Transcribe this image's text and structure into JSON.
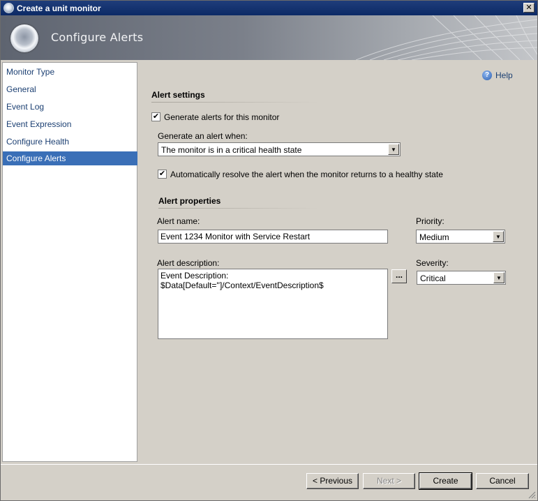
{
  "window": {
    "title": "Create a unit monitor",
    "close_label": "✕"
  },
  "banner": {
    "title": "Configure Alerts"
  },
  "sidebar": {
    "items": [
      {
        "label": "Monitor Type"
      },
      {
        "label": "General"
      },
      {
        "label": "Event Log"
      },
      {
        "label": "Event Expression"
      },
      {
        "label": "Configure Health"
      },
      {
        "label": "Configure Alerts",
        "selected": true
      }
    ]
  },
  "help": {
    "label": "Help",
    "icon": "help-icon"
  },
  "alert_settings": {
    "title": "Alert settings",
    "generate_alerts": {
      "label": "Generate alerts for this monitor",
      "checked": true
    },
    "generate_when": {
      "label": "Generate an alert when:",
      "value": "The monitor is in a critical health state"
    },
    "auto_resolve": {
      "label": "Automatically resolve the alert when the monitor returns to a healthy state",
      "checked": true
    }
  },
  "alert_properties": {
    "title": "Alert properties",
    "alert_name": {
      "label": "Alert name:",
      "value": "Event 1234 Monitor with Service Restart"
    },
    "priority": {
      "label": "Priority:",
      "value": "Medium"
    },
    "alert_description": {
      "label": "Alert description:",
      "value": "Event Description: $Data[Default='']/Context/EventDescription$"
    },
    "ellipsis_label": "...",
    "severity": {
      "label": "Severity:",
      "value": "Critical"
    }
  },
  "footer": {
    "previous": "< Previous",
    "next": "Next >",
    "create": "Create",
    "cancel": "Cancel"
  },
  "check_mark": "✔",
  "dropdown_arrow": "▼",
  "colors": {
    "selection": "#3a6fb7",
    "link": "#1b3f72",
    "titlebar": "#0c2a66"
  }
}
